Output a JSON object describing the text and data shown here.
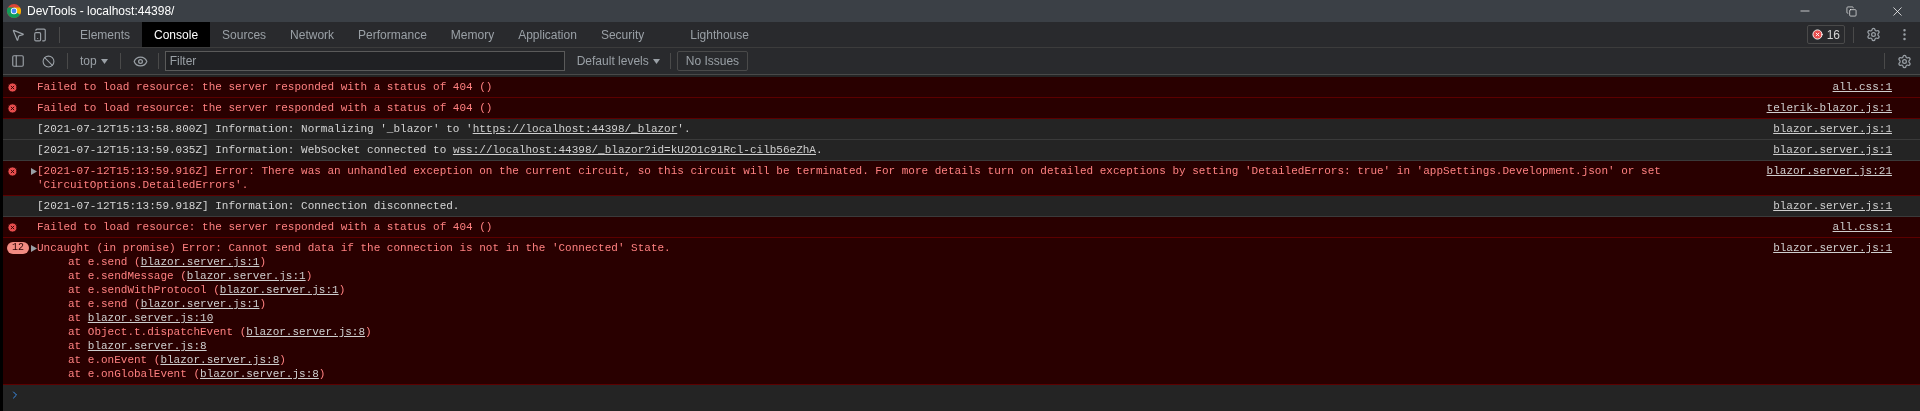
{
  "window": {
    "title": "DevTools - localhost:44398/"
  },
  "tabs": [
    {
      "label": "Elements",
      "selected": false
    },
    {
      "label": "Console",
      "selected": true
    },
    {
      "label": "Sources",
      "selected": false
    },
    {
      "label": "Network",
      "selected": false
    },
    {
      "label": "Performance",
      "selected": false
    },
    {
      "label": "Memory",
      "selected": false
    },
    {
      "label": "Application",
      "selected": false
    },
    {
      "label": "Security",
      "selected": false
    },
    {
      "label": "Lighthouse",
      "selected": false
    }
  ],
  "error_count": "16",
  "toolbar": {
    "context": "top",
    "filter": {
      "placeholder": "Filter"
    },
    "levels": "Default levels",
    "issues": "No Issues"
  },
  "messages": [
    {
      "kind": "error",
      "segments": [
        {
          "text": "Failed to load resource: the server responded with a status of 404 ()",
          "link": false
        }
      ],
      "source": "all.css:1"
    },
    {
      "kind": "error",
      "segments": [
        {
          "text": "Failed to load resource: the server responded with a status of 404 ()",
          "link": false
        }
      ],
      "source": "telerik-blazor.js:1"
    },
    {
      "kind": "info",
      "segments": [
        {
          "text": "[2021-07-12T15:13:58.800Z] Information: Normalizing '_blazor' to '",
          "link": false
        },
        {
          "text": "https://localhost:44398/_blazor",
          "link": true
        },
        {
          "text": "'.",
          "link": false
        }
      ],
      "source": "blazor.server.js:1"
    },
    {
      "kind": "info",
      "segments": [
        {
          "text": "[2021-07-12T15:13:59.035Z] Information: WebSocket connected to ",
          "link": false
        },
        {
          "text": "wss://localhost:44398/_blazor?id=kU2O1c91Rcl-cilb56eZhA",
          "link": true
        },
        {
          "text": ".",
          "link": false
        }
      ],
      "source": "blazor.server.js:1"
    },
    {
      "kind": "error",
      "expanded": false,
      "segments": [
        {
          "text": "[2021-07-12T15:13:59.916Z] Error: There was an unhandled exception on the current circuit, so this circuit will be terminated. For more details turn on detailed exceptions by setting 'DetailedErrors: true' in 'appSettings.Development.json' or set 'CircuitOptions.DetailedErrors'.",
          "link": false
        }
      ],
      "source": "blazor.server.js:21"
    },
    {
      "kind": "info",
      "segments": [
        {
          "text": "[2021-07-12T15:13:59.918Z] Information: Connection disconnected.",
          "link": false
        }
      ],
      "source": "blazor.server.js:1"
    },
    {
      "kind": "error",
      "segments": [
        {
          "text": "Failed to load resource: the server responded with a status of 404 ()",
          "link": false
        }
      ],
      "source": "all.css:1"
    },
    {
      "kind": "error",
      "repeat": "12",
      "expanded": false,
      "segments": [
        {
          "text": "Uncaught (in promise) Error: Cannot send data if the connection is not in the 'Connected' State.",
          "link": false
        }
      ],
      "source": "blazor.server.js:1",
      "stack": [
        [
          {
            "text": "at e.send (",
            "link": false
          },
          {
            "text": "blazor.server.js:1",
            "link": true
          },
          {
            "text": ")",
            "link": false
          }
        ],
        [
          {
            "text": "at e.sendMessage (",
            "link": false
          },
          {
            "text": "blazor.server.js:1",
            "link": true
          },
          {
            "text": ")",
            "link": false
          }
        ],
        [
          {
            "text": "at e.sendWithProtocol (",
            "link": false
          },
          {
            "text": "blazor.server.js:1",
            "link": true
          },
          {
            "text": ")",
            "link": false
          }
        ],
        [
          {
            "text": "at e.send (",
            "link": false
          },
          {
            "text": "blazor.server.js:1",
            "link": true
          },
          {
            "text": ")",
            "link": false
          }
        ],
        [
          {
            "text": "at ",
            "link": false
          },
          {
            "text": "blazor.server.js:10",
            "link": true
          }
        ],
        [
          {
            "text": "at Object.t.dispatchEvent (",
            "link": false
          },
          {
            "text": "blazor.server.js:8",
            "link": true
          },
          {
            "text": ")",
            "link": false
          }
        ],
        [
          {
            "text": "at ",
            "link": false
          },
          {
            "text": "blazor.server.js:8",
            "link": true
          }
        ],
        [
          {
            "text": "at e.onEvent (",
            "link": false
          },
          {
            "text": "blazor.server.js:8",
            "link": true
          },
          {
            "text": ")",
            "link": false
          }
        ],
        [
          {
            "text": "at e.onGlobalEvent (",
            "link": false
          },
          {
            "text": "blazor.server.js:8",
            "link": true
          },
          {
            "text": ")",
            "link": false
          }
        ]
      ]
    }
  ]
}
